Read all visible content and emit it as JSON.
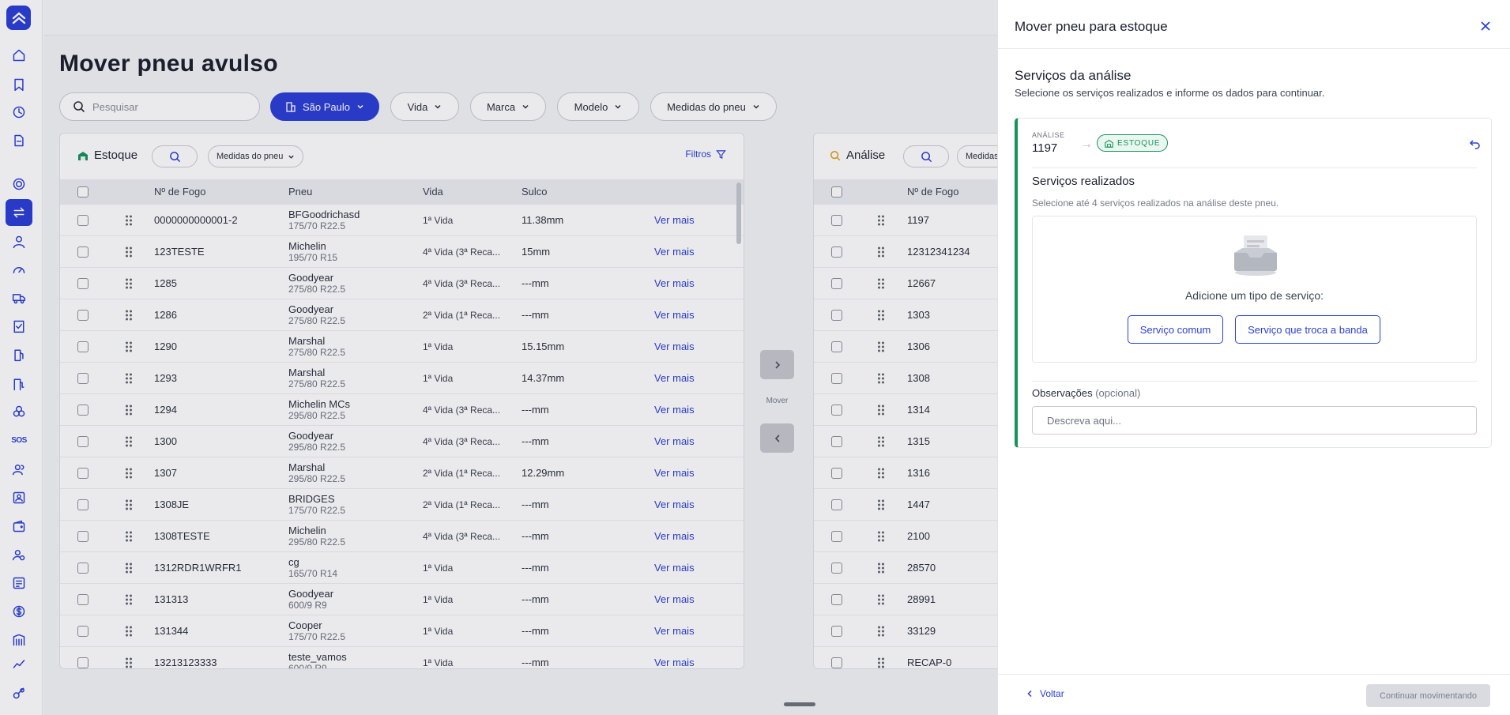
{
  "page": {
    "title": "Mover pneu avulso",
    "search_placeholder": "Pesquisar",
    "filters": [
      "São Paulo",
      "Vida",
      "Marca",
      "Modelo",
      "Medidas do pneu"
    ]
  },
  "sidebar": {
    "items": [
      "home-icon",
      "bookmark-icon",
      "clock-icon",
      "document-icon",
      "tire-icon",
      "transfer-icon",
      "driver-icon",
      "gauge-icon",
      "truck-icon",
      "checklist-icon",
      "fuel-icon",
      "station-icon",
      "cubes-icon",
      "sos-icon",
      "users-icon",
      "badge-icon",
      "wallet-icon",
      "user-settings-icon",
      "report-icon",
      "dollar-icon",
      "library-icon",
      "chart-icon",
      "tools-icon"
    ],
    "sos_label": "SOS",
    "active": "transfer-icon"
  },
  "estoque": {
    "title": "Estoque",
    "measure_filter": "Medidas do pneu",
    "filters_label": "Filtros",
    "columns": [
      "Nº de Fogo",
      "Pneu",
      "Vida",
      "Sulco"
    ],
    "link_label": "Ver mais",
    "rows": [
      {
        "fogo": "0000000000001-2",
        "marca": "BFGoodrichasd",
        "medida": "175/70 R22.5",
        "vida": "1ª Vida",
        "sulco": "11.38mm"
      },
      {
        "fogo": "123TESTE",
        "marca": "Michelin",
        "medida": "195/70 R15",
        "vida": "4ª Vida (3ª Reca...",
        "sulco": "15mm"
      },
      {
        "fogo": "1285",
        "marca": "Goodyear",
        "medida": "275/80 R22.5",
        "vida": "4ª Vida (3ª Reca...",
        "sulco": "---mm"
      },
      {
        "fogo": "1286",
        "marca": "Goodyear",
        "medida": "275/80 R22.5",
        "vida": "2ª Vida (1ª Reca...",
        "sulco": "---mm"
      },
      {
        "fogo": "1290",
        "marca": "Marshal",
        "medida": "275/80 R22.5",
        "vida": "1ª Vida",
        "sulco": "15.15mm"
      },
      {
        "fogo": "1293",
        "marca": "Marshal",
        "medida": "275/80 R22.5",
        "vida": "1ª Vida",
        "sulco": "14.37mm"
      },
      {
        "fogo": "1294",
        "marca": "Michelin MCs",
        "medida": "295/80 R22.5",
        "vida": "4ª Vida (3ª Reca...",
        "sulco": "---mm"
      },
      {
        "fogo": "1300",
        "marca": "Goodyear",
        "medida": "295/80 R22.5",
        "vida": "4ª Vida (3ª Reca...",
        "sulco": "---mm"
      },
      {
        "fogo": "1307",
        "marca": "Marshal",
        "medida": "295/80 R22.5",
        "vida": "2ª Vida (1ª Reca...",
        "sulco": "12.29mm"
      },
      {
        "fogo": "1308JE",
        "marca": "BRIDGES",
        "medida": "175/70 R22.5",
        "vida": "2ª Vida (1ª Reca...",
        "sulco": "---mm"
      },
      {
        "fogo": "1308TESTE",
        "marca": "Michelin",
        "medida": "295/80 R22.5",
        "vida": "4ª Vida (3ª Reca...",
        "sulco": "---mm"
      },
      {
        "fogo": "1312RDR1WRFR1",
        "marca": "cg",
        "medida": "165/70 R14",
        "vida": "1ª Vida",
        "sulco": "---mm"
      },
      {
        "fogo": "131313",
        "marca": "Goodyear",
        "medida": "600/9 R9",
        "vida": "1ª Vida",
        "sulco": "---mm"
      },
      {
        "fogo": "131344",
        "marca": "Cooper",
        "medida": "175/70 R22.5",
        "vida": "1ª Vida",
        "sulco": "---mm"
      },
      {
        "fogo": "13213123333",
        "marca": "teste_vamos",
        "medida": "600/9 R9",
        "vida": "1ª Vida",
        "sulco": "---mm"
      }
    ]
  },
  "analise": {
    "title": "Análise",
    "measure_filter_partial": "Medidas",
    "columns": [
      "Nº de Fogo"
    ],
    "rows": [
      "1197",
      "12312341234",
      "12667",
      "1303",
      "1306",
      "1308",
      "1314",
      "1315",
      "1316",
      "1447",
      "2100",
      "28570",
      "28991",
      "33129",
      "RECAP-0"
    ]
  },
  "move": {
    "label": "Mover"
  },
  "drawer": {
    "title": "Mover pneu para estoque",
    "section_title": "Serviços da análise",
    "section_subtitle": "Selecione os serviços realizados e informe os dados para continuar.",
    "analise_label": "ANÁLISE",
    "analise_value": "1197",
    "badge": "ESTOQUE",
    "services_title": "Serviços realizados",
    "services_subtitle": "Selecione até 4 serviços realizados na análise deste pneu.",
    "empty_text": "Adicione um tipo de serviço:",
    "btn_common": "Serviço comum",
    "btn_tread": "Serviço que troca a banda",
    "obs_label": "Observações",
    "obs_optional": "(opcional)",
    "obs_placeholder": "Descreva aqui...",
    "back": "Voltar",
    "continue": "Continuar movimentando"
  },
  "colors": {
    "primary": "#2b3fd6",
    "success": "#17925b",
    "disabled": "#d9dbe0"
  }
}
